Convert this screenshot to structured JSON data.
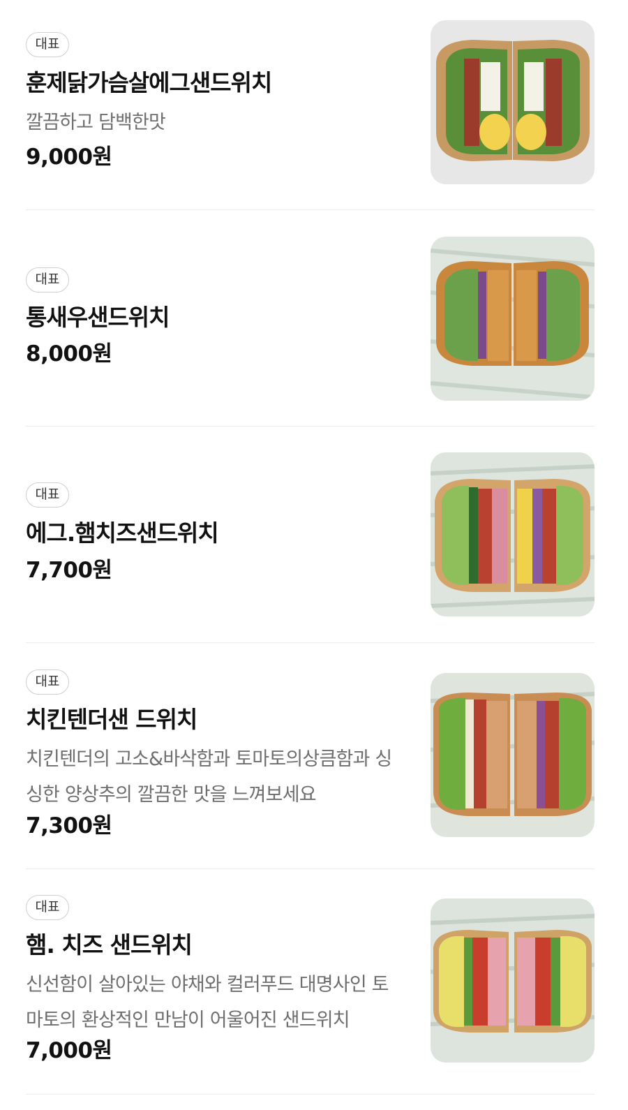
{
  "menu_items": [
    {
      "badge": "대표",
      "name": "훈제닭가슴살에그샌드위치",
      "description": "깔끔하고 담백한맛",
      "price": "9,000원",
      "image": "smoked-chicken-egg-sandwich-photo"
    },
    {
      "badge": "대표",
      "name": "통새우샌드위치",
      "description": "",
      "price": "8,000원",
      "image": "whole-shrimp-sandwich-photo"
    },
    {
      "badge": "대표",
      "name": "에그.햄치즈샌드위치",
      "description": "",
      "price": "7,700원",
      "image": "egg-ham-cheese-sandwich-photo"
    },
    {
      "badge": "대표",
      "name": "치킨텐더샌 드위치",
      "description": "치킨텐더의 고소&바삭함과 토마토의상큼함과 싱싱한 양상추의 깔끔한 맛을 느껴보세요",
      "price": "7,300원",
      "image": "chicken-tender-sandwich-photo"
    },
    {
      "badge": "대표",
      "name": "햄. 치즈 샌드위치",
      "description": "신선함이 살아있는 야채와 컬러푸드 대명사인 토마토의 환상적인 만남이 어울어진 샌드위치",
      "price": "7,000원",
      "image": "ham-cheese-sandwich-photo"
    }
  ]
}
